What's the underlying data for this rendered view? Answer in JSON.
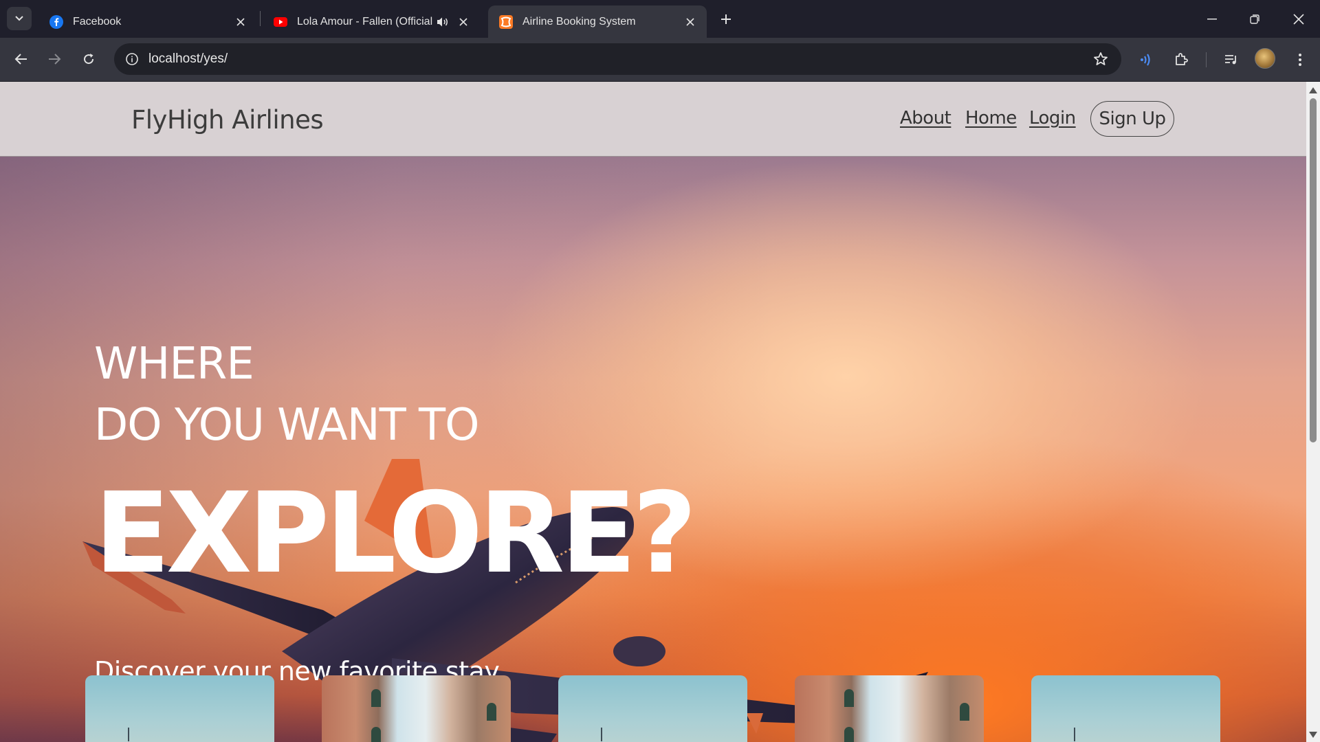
{
  "browser": {
    "tabs": [
      {
        "title": "Facebook",
        "icon": "facebook-icon",
        "active": false
      },
      {
        "title": "Lola Amour - Fallen (Official Ly",
        "icon": "youtube-icon",
        "active": false,
        "audio": true
      },
      {
        "title": "Airline Booking System",
        "icon": "xampp-icon",
        "active": true
      }
    ],
    "url": "localhost/yes/"
  },
  "site": {
    "brand": "FlyHigh Airlines",
    "nav": {
      "about": "About",
      "home": "Home",
      "login": "Login",
      "signup": "Sign Up"
    }
  },
  "hero": {
    "line1": "WHERE",
    "line2": "DO YOU WANT TO",
    "line3": "EXPLORE?",
    "subtitle": "Discover your new favorite stay"
  },
  "cards": [
    {
      "image": "sky-boat"
    },
    {
      "image": "venice-street"
    },
    {
      "image": "sky-boat"
    },
    {
      "image": "venice-street"
    },
    {
      "image": "sky-boat"
    }
  ],
  "colors": {
    "tabbar": "#1f1f2b",
    "toolbar": "#35363f",
    "header_bg": "#d8d1d3",
    "hero_text": "#ffffff"
  }
}
